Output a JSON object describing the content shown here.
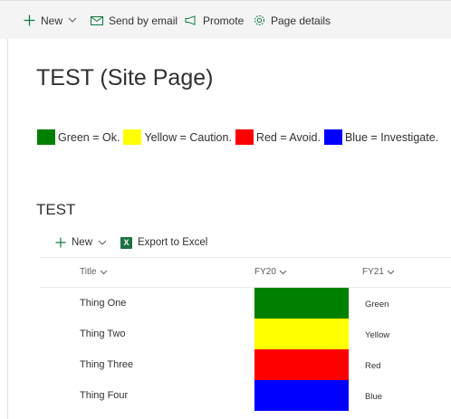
{
  "command_bar": {
    "new_label": "New",
    "send_label": "Send by email",
    "promote_label": "Promote",
    "page_details_label": "Page details"
  },
  "page": {
    "title": "TEST (Site Page)"
  },
  "legend": [
    {
      "color": "#008000",
      "label": "Green = Ok."
    },
    {
      "color": "#ffff00",
      "label": "Yellow = Caution."
    },
    {
      "color": "#ff0000",
      "label": "Red = Avoid."
    },
    {
      "color": "#0000ff",
      "label": "Blue = Investigate."
    }
  ],
  "list": {
    "title": "TEST",
    "new_label": "New",
    "export_label": "Export to Excel",
    "columns": {
      "title": "Title",
      "fy20": "FY20",
      "fy21": "FY21"
    },
    "rows": [
      {
        "title": "Thing One",
        "fy20_color": "#008000",
        "fy21": "Green"
      },
      {
        "title": "Thing Two",
        "fy20_color": "#ffff00",
        "fy21": "Yellow"
      },
      {
        "title": "Thing Three",
        "fy20_color": "#ff0000",
        "fy21": "Red"
      },
      {
        "title": "Thing Four",
        "fy20_color": "#0000ff",
        "fy21": "Blue"
      }
    ]
  }
}
